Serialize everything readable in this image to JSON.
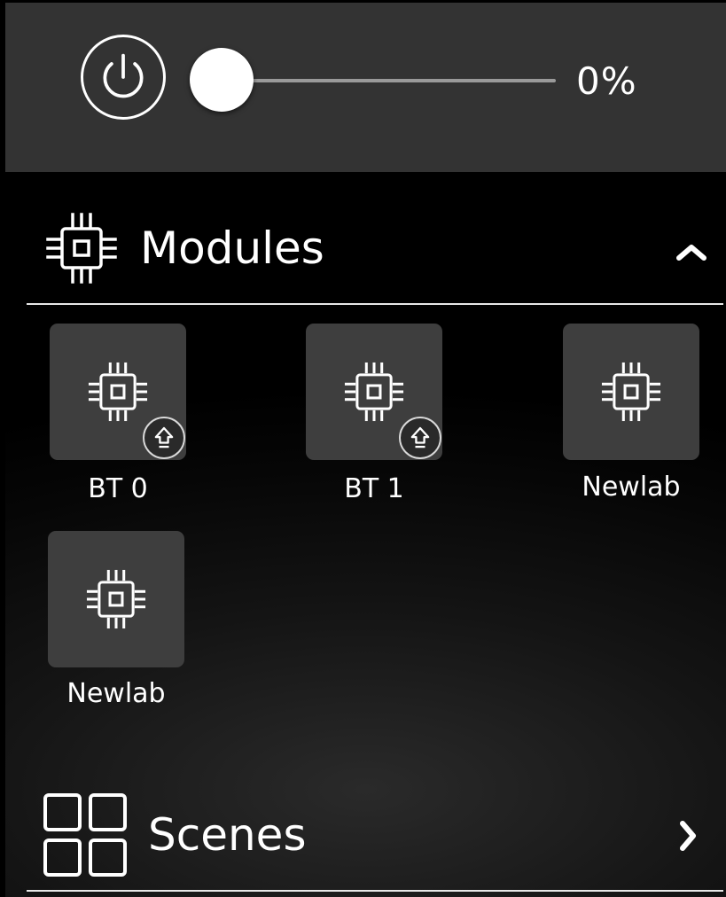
{
  "power": {
    "level_label": "0%",
    "level_value": 0
  },
  "modules": {
    "title": "Modules",
    "expanded": true,
    "items": [
      {
        "label": "BT 0",
        "update_badge": true
      },
      {
        "label": "BT 1",
        "update_badge": true
      },
      {
        "label": "Newlab",
        "update_badge": false
      },
      {
        "label": "Newlab",
        "update_badge": false
      }
    ]
  },
  "scenes": {
    "title": "Scenes"
  },
  "colors": {
    "top_bar": "#333333",
    "tile": "#3e3e3e",
    "text": "#ffffff",
    "track": "#9a9a9a"
  },
  "icons": {
    "power": "power-icon",
    "chip": "chip-icon",
    "update": "update-arrow-icon",
    "collapse": "chevron-up-icon",
    "scenes": "grid-icon",
    "navigate": "chevron-right-icon"
  }
}
